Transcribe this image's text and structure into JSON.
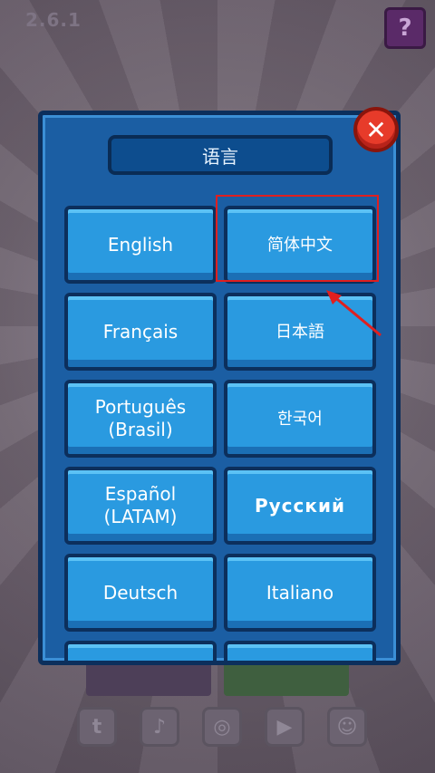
{
  "background": {
    "version": "2.6.1",
    "help_icon": "?",
    "socials": [
      "twitter-icon",
      "tiktok-icon",
      "instagram-icon",
      "youtube-icon",
      "discord-icon"
    ]
  },
  "dialog": {
    "title": "语言",
    "close_icon": "close-icon",
    "languages": [
      {
        "label": "English"
      },
      {
        "label": "简体中文"
      },
      {
        "label": "Français"
      },
      {
        "label": "日本語"
      },
      {
        "label": "Português\n(Brasil)"
      },
      {
        "label": "한국어"
      },
      {
        "label": "Español\n(LATAM)"
      },
      {
        "label": "Русский"
      },
      {
        "label": "Deutsch"
      },
      {
        "label": "Italiano"
      }
    ]
  },
  "colors": {
    "panel": "#1b5ea3",
    "button": "#2a9ae0",
    "close": "#e73b2a",
    "highlight": "#e01f1f"
  }
}
